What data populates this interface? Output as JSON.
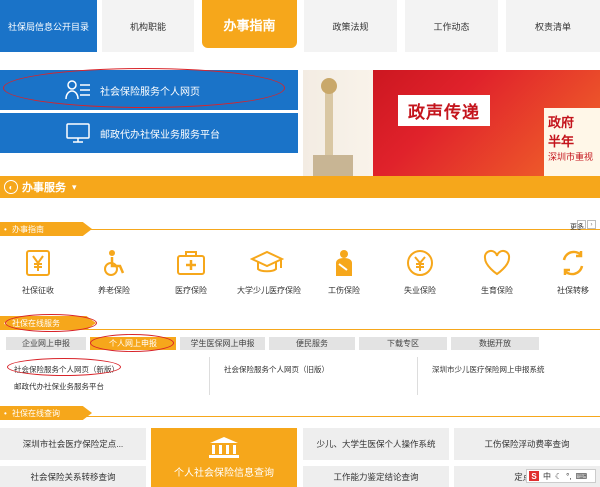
{
  "topnav": [
    {
      "label": "社保局信息公开目录",
      "style": "blue"
    },
    {
      "label": "机构职能",
      "style": "gray"
    },
    {
      "label": "办事指南",
      "style": "orange"
    },
    {
      "label": "政策法规",
      "style": "gray"
    },
    {
      "label": "工作动态",
      "style": "gray"
    },
    {
      "label": "权责清单",
      "style": "gray"
    }
  ],
  "hero": {
    "personal_label": "社会保险服务个人网页",
    "postal_label": "邮政代办社保业务服务平台"
  },
  "banner": {
    "title": "政声传递",
    "side_big": "政府",
    "side_big2": "半年",
    "side_small": "深圳市重视"
  },
  "section": {
    "title": "办事服务",
    "guide_tab": "办事指南",
    "more": "更多",
    "online_tab": "社保在线服务",
    "query_tab": "社保在线查询"
  },
  "services": [
    {
      "label": "社保征收",
      "icon": "yen-icon"
    },
    {
      "label": "养老保险",
      "icon": "wheelchair-icon"
    },
    {
      "label": "医疗保险",
      "icon": "medical-kit-icon"
    },
    {
      "label": "大学少儿医疗保险",
      "icon": "graduation-cap-icon"
    },
    {
      "label": "工伤保险",
      "icon": "injured-person-icon"
    },
    {
      "label": "失业保险",
      "icon": "currency-icon"
    },
    {
      "label": "生育保险",
      "icon": "heart-icon"
    },
    {
      "label": "社保转移",
      "icon": "transfer-icon"
    }
  ],
  "subtabs": [
    {
      "label": "企业网上申报",
      "active": false
    },
    {
      "label": "个人网上申报",
      "active": true
    },
    {
      "label": "学生医保网上申报",
      "active": false
    },
    {
      "label": "便民服务",
      "active": false
    },
    {
      "label": "下载专区",
      "active": false
    },
    {
      "label": "数据开放",
      "active": false
    }
  ],
  "links": {
    "new_personal": "社会保险服务个人网页（新版）",
    "old_personal": "社会保险服务个人网页（旧版）",
    "child_medical": "深圳市少儿医疗保险网上申报系统",
    "postal": "邮政代办社保业务服务平台"
  },
  "tiles": {
    "row1_left": "深圳市社会医疗保险定点...",
    "big": "个人社会保险信息查询",
    "row1_mid": "少儿、大学生医保个人操作系统",
    "row1_right": "工伤保险浮动费率查询",
    "row2_left": "社会保险关系转移查询",
    "row2_mid": "工作能力鉴定结论查询",
    "row2_right": "定点医"
  },
  "ime": {
    "lang": "中"
  },
  "colors": {
    "blue": "#1a73c8",
    "orange": "#f6a71b",
    "red": "#d8242a"
  }
}
